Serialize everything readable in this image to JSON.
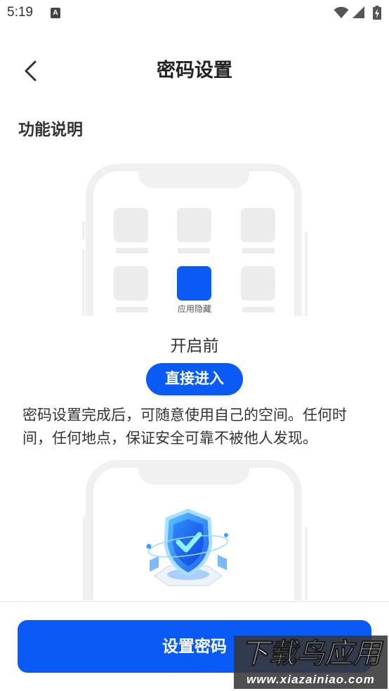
{
  "status_bar": {
    "time": "5:19",
    "notification_badge": "A",
    "icons": [
      "wifi-icon",
      "signal-icon",
      "battery-charging-icon"
    ]
  },
  "header": {
    "title": "密码设置",
    "back_icon": "chevron-left-icon"
  },
  "section": {
    "title": "功能说明"
  },
  "illustration_before": {
    "app_label": "应用隐藏",
    "caption": "开启前"
  },
  "enter_button": {
    "label": "直接进入"
  },
  "description": "密码设置完成后，可随意使用自己的空间。任何时间，任何地点，保证安全可靠不被他人发现。",
  "illustration_after": {
    "icon": "shield-check-icon"
  },
  "footer": {
    "set_password_label": "设置密码"
  },
  "watermark": {
    "brand": "下载鸟应用",
    "url": "www.xiazainiao.com"
  },
  "colors": {
    "accent": "#0a5bf6",
    "placeholder": "#ececec",
    "text": "#333333"
  }
}
